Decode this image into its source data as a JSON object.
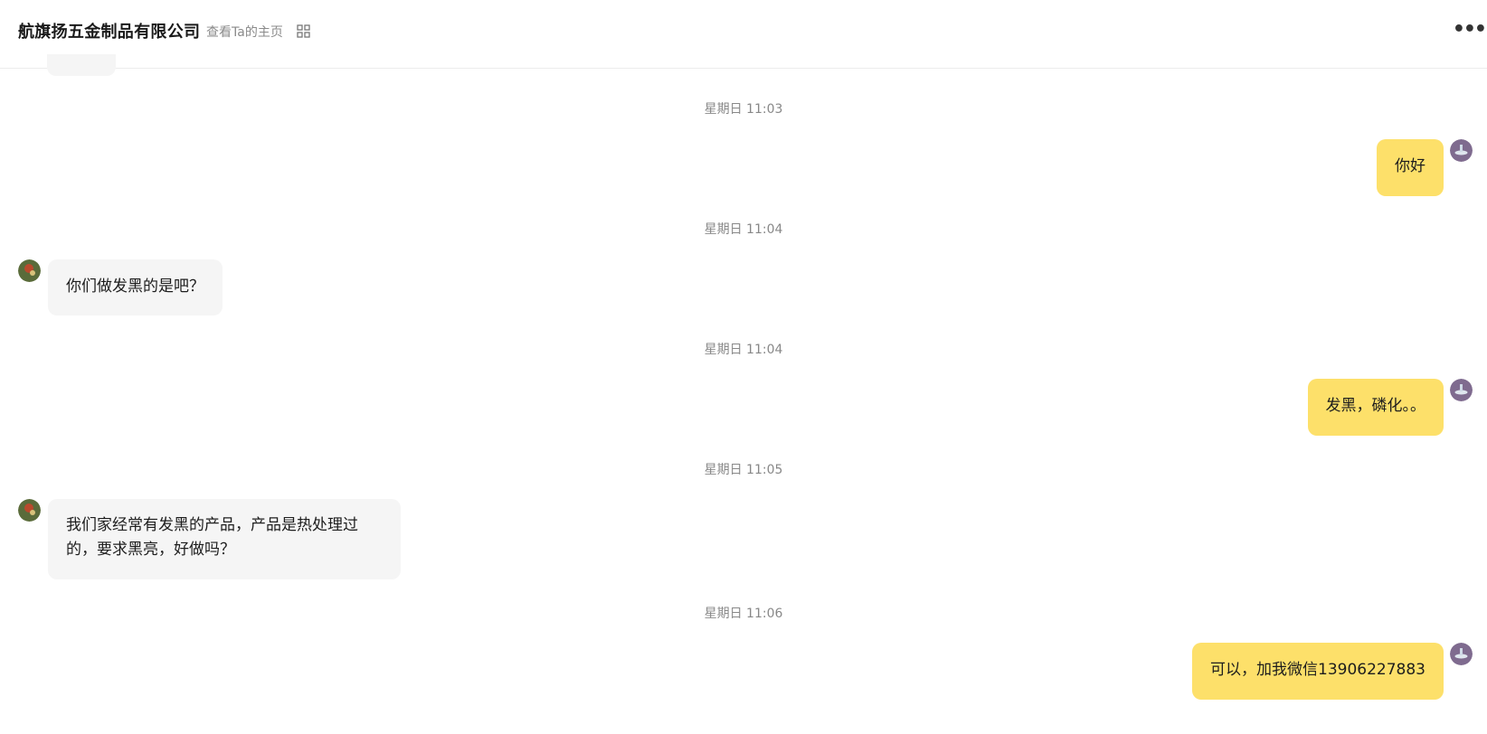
{
  "header": {
    "title": "航旗扬五金制品有限公司",
    "homepage_link": "查看Ta的主页",
    "qr_icon": "qr-code-icon",
    "more_icon": "more-dots-icon",
    "more_glyph": "•••"
  },
  "messages": [
    {
      "timestamp": "星期日 11:03",
      "direction": "out",
      "text": "你好"
    },
    {
      "timestamp": "星期日 11:04",
      "direction": "in",
      "text": "你们做发黑的是吧？"
    },
    {
      "timestamp": "星期日 11:04",
      "direction": "out",
      "text": "发黑，磷化。。"
    },
    {
      "timestamp": "星期日 11:05",
      "direction": "in",
      "text_line1": "我们家经常有发黑的产品，产品是热处理过",
      "text_line2": "的，要求黑亮，好做吗？"
    },
    {
      "timestamp": "星期日 11:06",
      "direction": "out",
      "text": "可以，加我微信13906227883"
    }
  ],
  "colors": {
    "outgoing_bubble": "#fde06a",
    "incoming_bubble": "#f5f5f5",
    "timestamp_text": "#888888"
  }
}
